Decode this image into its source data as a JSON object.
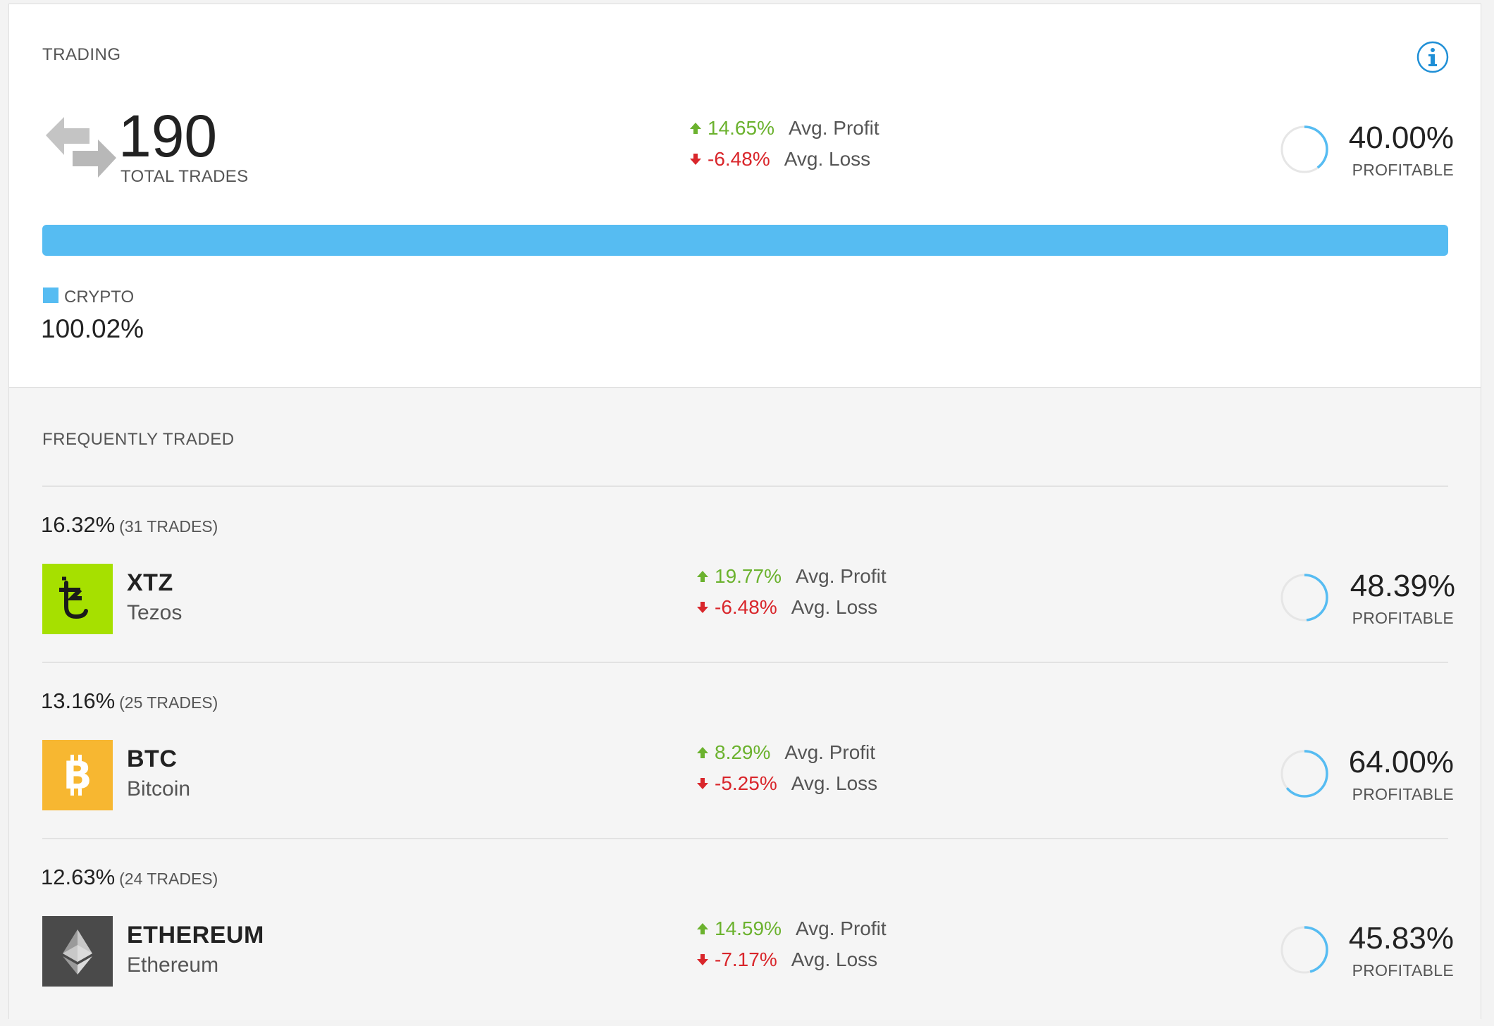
{
  "trading": {
    "title": "TRADING",
    "total_trades": "190",
    "total_trades_label": "TOTAL TRADES",
    "avg_profit": "14.65%",
    "avg_profit_label": "Avg. Profit",
    "avg_loss": "-6.48%",
    "avg_loss_label": "Avg. Loss",
    "profitable_pct": "40.00%",
    "profitable_fraction": 0.4,
    "profitable_label": "PROFITABLE",
    "allocation": {
      "label": "CRYPTO",
      "value": "100.02%",
      "color": "#56bcf2"
    }
  },
  "frequently_traded": {
    "title": "FREQUENTLY TRADED",
    "items": [
      {
        "share": "16.32%",
        "trades": "(31 TRADES)",
        "symbol": "XTZ",
        "name": "Tezos",
        "logo_icon": "tezos-icon",
        "logo_color": "#a6e000",
        "avg_profit": "19.77%",
        "avg_profit_label": "Avg. Profit",
        "avg_loss": "-6.48%",
        "avg_loss_label": "Avg. Loss",
        "profitable_pct": "48.39%",
        "profitable_fraction": 0.4839,
        "profitable_label": "PROFITABLE"
      },
      {
        "share": "13.16%",
        "trades": "(25 TRADES)",
        "symbol": "BTC",
        "name": "Bitcoin",
        "logo_icon": "bitcoin-icon",
        "logo_color": "#f7b731",
        "avg_profit": "8.29%",
        "avg_profit_label": "Avg. Profit",
        "avg_loss": "-5.25%",
        "avg_loss_label": "Avg. Loss",
        "profitable_pct": "64.00%",
        "profitable_fraction": 0.64,
        "profitable_label": "PROFITABLE"
      },
      {
        "share": "12.63%",
        "trades": "(24 TRADES)",
        "symbol": "ETHEREUM",
        "name": "Ethereum",
        "logo_icon": "ethereum-icon",
        "logo_color": "#4a4a4a",
        "avg_profit": "14.59%",
        "avg_profit_label": "Avg. Profit",
        "avg_loss": "-7.17%",
        "avg_loss_label": "Avg. Loss",
        "profitable_pct": "45.83%",
        "profitable_fraction": 0.4583,
        "profitable_label": "PROFITABLE"
      }
    ]
  },
  "colors": {
    "accent": "#56bcf2",
    "profit": "#6bb22e",
    "loss": "#d9262b",
    "ring_track": "#e6e6e6"
  }
}
